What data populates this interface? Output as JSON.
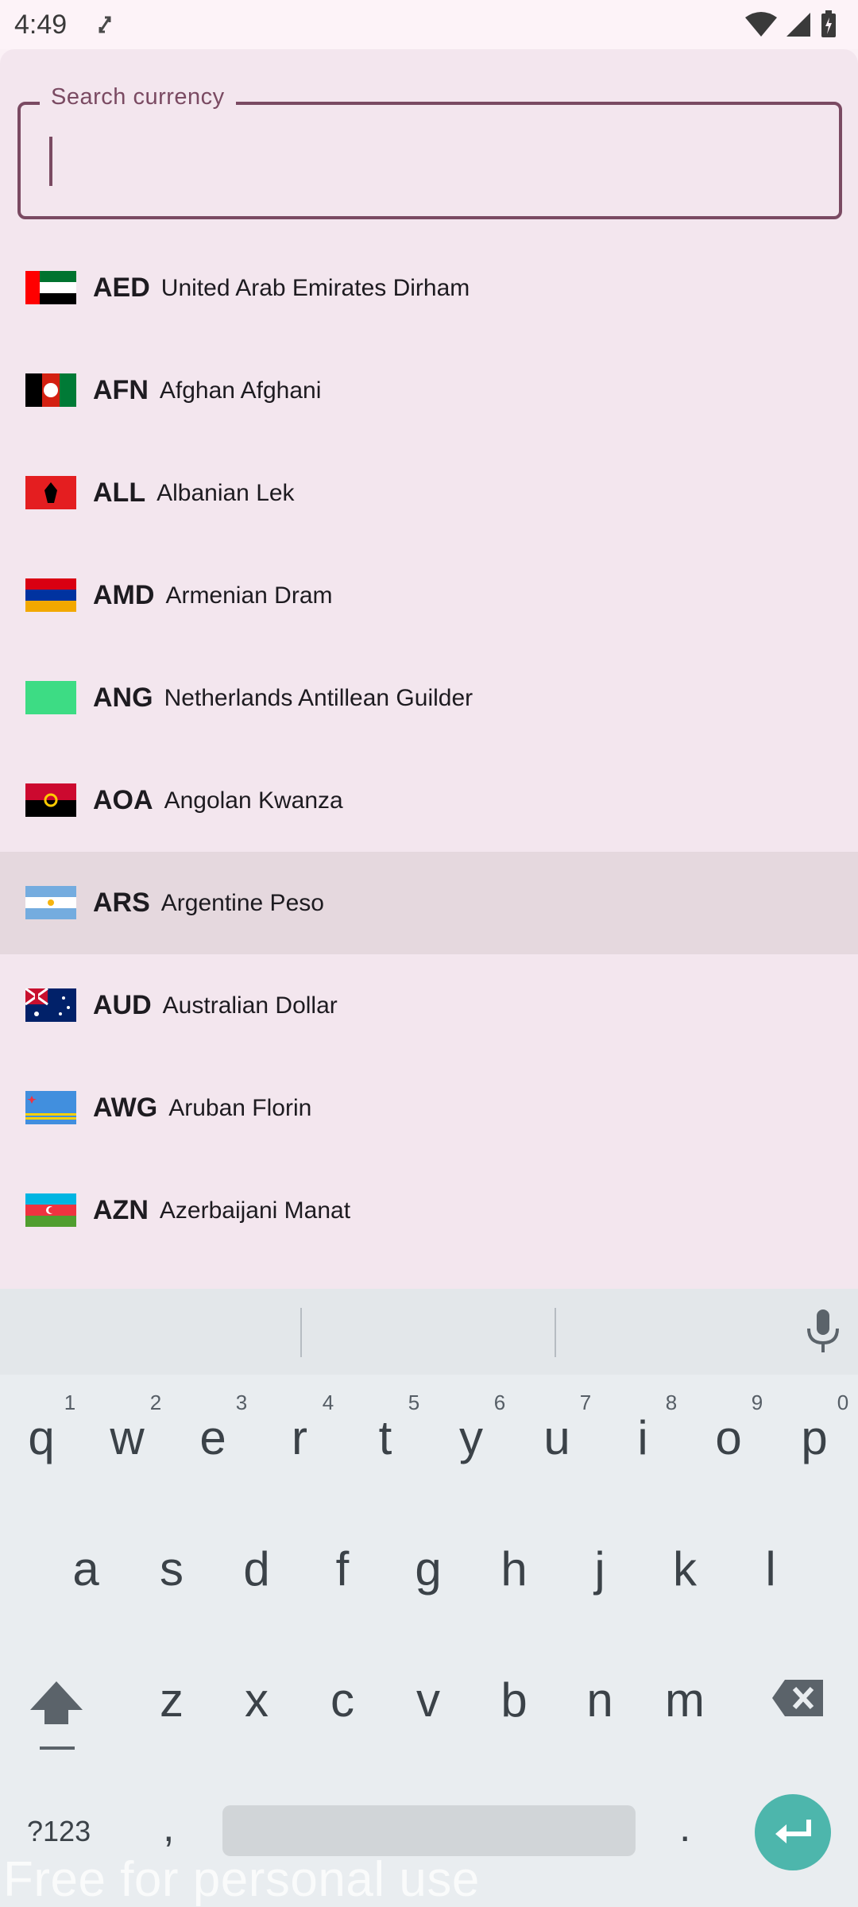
{
  "status_bar": {
    "time": "4:49"
  },
  "search": {
    "label": "Search currency",
    "value": ""
  },
  "currencies": [
    {
      "code": "AED",
      "name": "United Arab Emirates Dirham",
      "flag": "flag-ae"
    },
    {
      "code": "AFN",
      "name": "Afghan Afghani",
      "flag": "flag-af"
    },
    {
      "code": "ALL",
      "name": "Albanian Lek",
      "flag": "flag-al"
    },
    {
      "code": "AMD",
      "name": "Armenian Dram",
      "flag": "flag-am"
    },
    {
      "code": "ANG",
      "name": "Netherlands Antillean Guilder",
      "flag": "flag-an"
    },
    {
      "code": "AOA",
      "name": "Angolan Kwanza",
      "flag": "flag-ao"
    },
    {
      "code": "ARS",
      "name": "Argentine Peso",
      "flag": "flag-ar",
      "selected": true
    },
    {
      "code": "AUD",
      "name": "Australian Dollar",
      "flag": "flag-au"
    },
    {
      "code": "AWG",
      "name": "Aruban Florin",
      "flag": "flag-aw"
    },
    {
      "code": "AZN",
      "name": "Azerbaijani Manat",
      "flag": "flag-az"
    }
  ],
  "keyboard": {
    "row1": [
      "q",
      "w",
      "e",
      "r",
      "t",
      "y",
      "u",
      "i",
      "o",
      "p"
    ],
    "row1_hints": [
      "1",
      "2",
      "3",
      "4",
      "5",
      "6",
      "7",
      "8",
      "9",
      "0"
    ],
    "row2": [
      "a",
      "s",
      "d",
      "f",
      "g",
      "h",
      "j",
      "k",
      "l"
    ],
    "row3": [
      "z",
      "x",
      "c",
      "v",
      "b",
      "n",
      "m"
    ],
    "symbols_label": "?123",
    "comma": ",",
    "period": "."
  },
  "watermark": "Free for personal use",
  "colors": {
    "accent": "#7a4a62",
    "sheet_bg": "#f3e6ee",
    "selected_row": "#e5d8de",
    "enter_key": "#4db6ac"
  }
}
